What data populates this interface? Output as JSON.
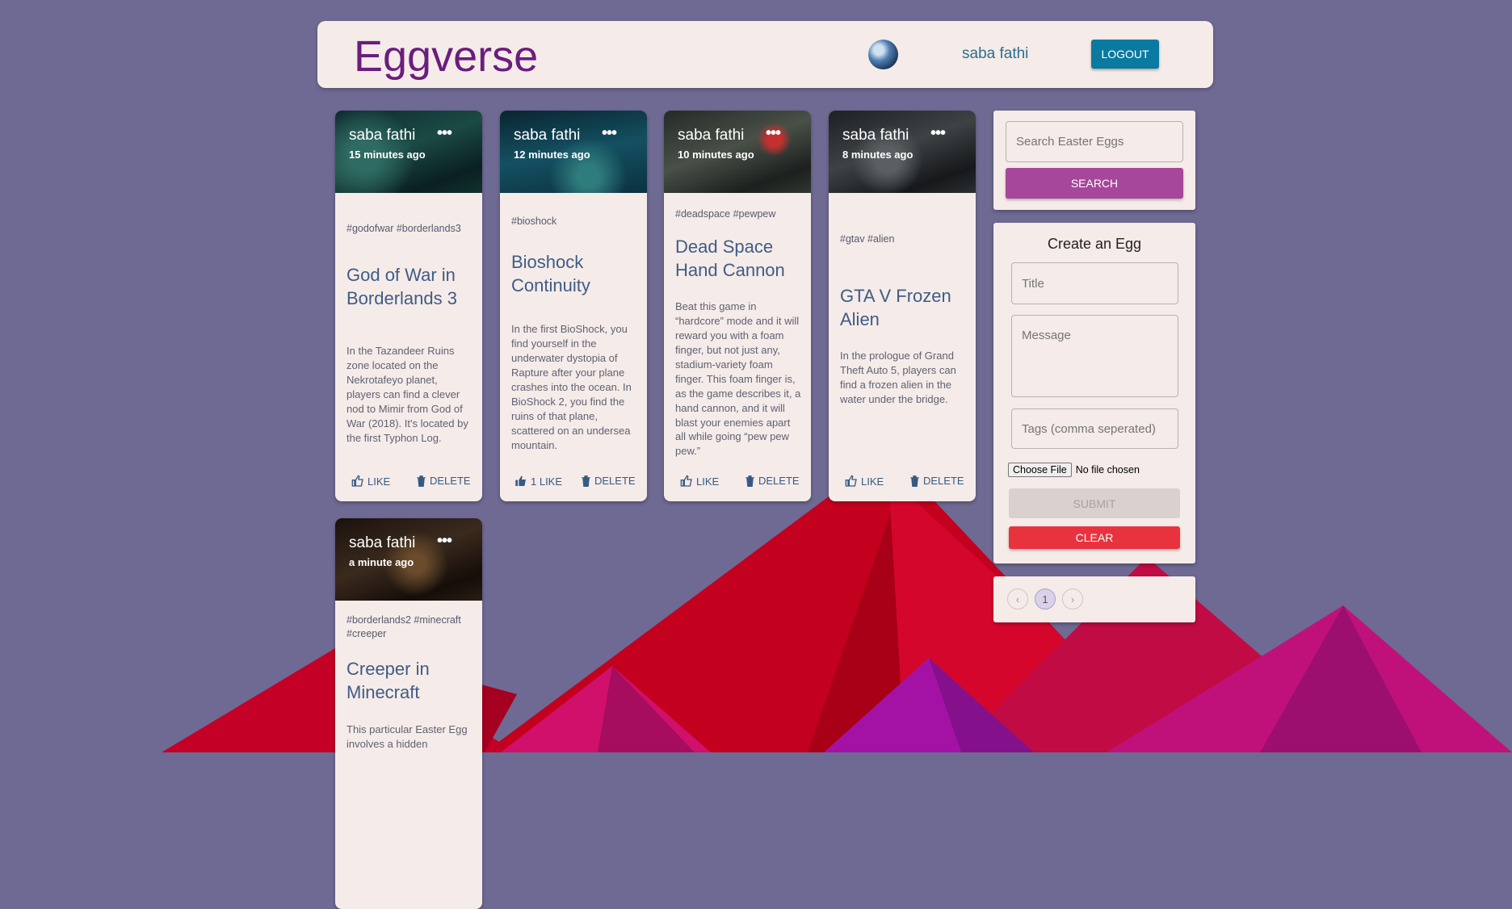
{
  "app": {
    "title": "Eggverse"
  },
  "header": {
    "user_name": "saba fathi",
    "logout_label": "LOGOUT"
  },
  "colors": {
    "background": "#6e6a93",
    "brand": "#6b1d7e",
    "logout": "#0a7aa1",
    "search": "#a6479b",
    "clear": "#e8333e",
    "panel": "#f5ebe8"
  },
  "posts": [
    {
      "author": "saba fathi",
      "time": "15 minutes ago",
      "tags": "#godofwar #borderlands3",
      "title": "God of War in Borderlands 3",
      "message": "In the Tazandeer Ruins zone located on the Nekrotafeyo planet, players can find a clever nod to Mimir from God of War (2018). It's located by the first Typhon Log.",
      "like_label": "LIKE",
      "delete_label": "DELETE"
    },
    {
      "author": "saba fathi",
      "time": "12 minutes ago",
      "tags": "#bioshock",
      "title": "Bioshock Continuity",
      "message": "In the first BioShock, you find yourself in the underwater dystopia of Rapture after your plane crashes into the ocean. In BioShock 2, you find the ruins of that plane, scattered on an undersea mountain.",
      "like_label": "1 LIKE",
      "delete_label": "DELETE"
    },
    {
      "author": "saba fathi",
      "time": "10 minutes ago",
      "tags": "#deadspace #pewpew",
      "title": "Dead Space Hand Cannon",
      "message": "Beat this game in “hardcore” mode and it will reward you with a foam finger, but not just any, stadium-variety foam finger. This foam finger is, as the game describes it, a hand cannon, and it will blast your enemies apart all while going “pew pew pew.”",
      "like_label": "LIKE",
      "delete_label": "DELETE"
    },
    {
      "author": "saba fathi",
      "time": "8 minutes ago",
      "tags": "#gtav #alien",
      "title": "GTA V Frozen Alien",
      "message": "In the prologue of Grand Theft Auto 5, players can find a frozen alien in the water under the bridge.",
      "like_label": "LIKE",
      "delete_label": "DELETE"
    },
    {
      "author": "saba fathi",
      "time": "a minute ago",
      "tags": "#borderlands2 #minecraft #creeper",
      "title": "Creeper in Minecraft",
      "message": "This particular Easter Egg involves a hidden",
      "like_label": "LIKE",
      "delete_label": "DELETE"
    }
  ],
  "search": {
    "placeholder": "Search Easter Eggs",
    "button_label": "SEARCH"
  },
  "form": {
    "heading": "Create an Egg",
    "title_placeholder": "Title",
    "message_placeholder": "Message",
    "tags_placeholder": "Tags (comma seperated)",
    "file_button": "Choose File",
    "file_status": "No file chosen",
    "submit_label": "SUBMIT",
    "clear_label": "CLEAR"
  },
  "pagination": {
    "prev": "‹",
    "current": "1",
    "next": "›"
  }
}
